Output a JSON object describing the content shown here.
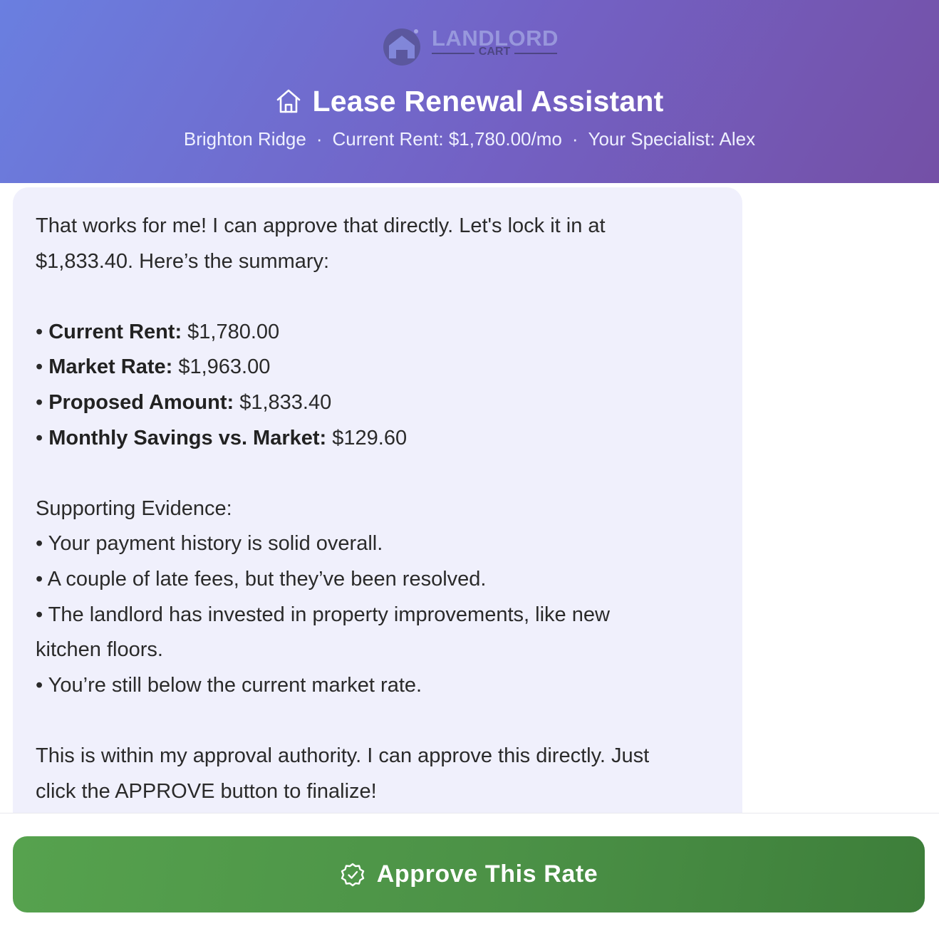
{
  "header": {
    "logo": {
      "word": "LANDLORD",
      "sub": "CART"
    },
    "title": "Lease Renewal Assistant",
    "title_icon": "home-icon",
    "subtitle": {
      "property": "Brighton Ridge",
      "rent": "Current Rent: $1,780.00/mo",
      "specialist": "Your Specialist: Alex",
      "separator": "·"
    },
    "gradient_colors": [
      "#6a7fe0",
      "#7361c4",
      "#7450a6"
    ]
  },
  "message": {
    "intro_line1": "That works for me! I can approve that directly. Let's lock it in at",
    "intro_line2": "$1,833.40. Here’s the summary:",
    "summary": [
      {
        "bullet": "•",
        "label": "Current Rent:",
        "value": "$1,780.00"
      },
      {
        "bullet": "•",
        "label": "Market Rate:",
        "value": "$1,963.00"
      },
      {
        "bullet": "•",
        "label": "Proposed Amount:",
        "value": "$1,833.40"
      },
      {
        "bullet": "•",
        "label": "Monthly Savings vs. Market:",
        "value": "$129.60"
      }
    ],
    "evidence_heading": "Supporting Evidence:",
    "evidence": [
      "• Your payment history is solid overall.",
      "• A couple of late fees, but they’ve been resolved.",
      "• The landlord has invested in property improvements, like new",
      "kitchen floors.",
      "• You’re still below the current market rate."
    ],
    "closing_line1": "This is within my approval authority. I can approve this directly. Just",
    "closing_line2": "click the APPROVE button to finalize!",
    "bubble_color": "#f0f0fc"
  },
  "approve_button": {
    "label": "Approve This Rate",
    "icon": "check-badge-icon",
    "color": "#4b9146"
  }
}
